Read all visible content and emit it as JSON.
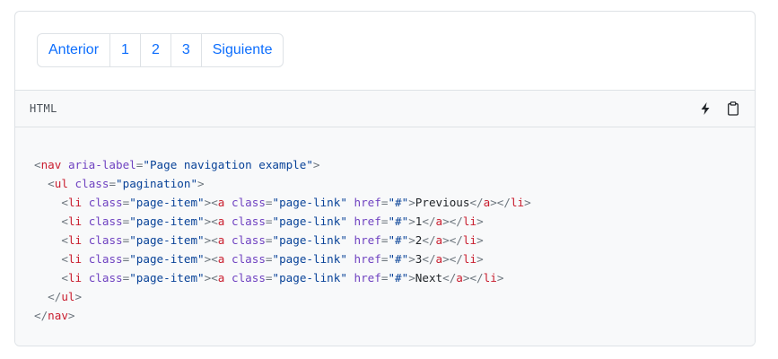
{
  "pagination": {
    "items": [
      {
        "label": "Anterior"
      },
      {
        "label": "1"
      },
      {
        "label": "2"
      },
      {
        "label": "3"
      },
      {
        "label": "Siguiente"
      }
    ]
  },
  "code": {
    "language": "HTML",
    "edit_icon": "lightning-icon",
    "copy_icon": "clipboard-icon",
    "lines": [
      {
        "indent": "",
        "parts": [
          [
            "punct",
            "<"
          ],
          [
            "tag",
            "nav"
          ],
          [
            "txt",
            " "
          ],
          [
            "attr",
            "aria-label"
          ],
          [
            "punct",
            "="
          ],
          [
            "val",
            "\"Page navigation example\""
          ],
          [
            "punct",
            ">"
          ]
        ]
      },
      {
        "indent": "  ",
        "parts": [
          [
            "punct",
            "<"
          ],
          [
            "tag",
            "ul"
          ],
          [
            "txt",
            " "
          ],
          [
            "attr",
            "class"
          ],
          [
            "punct",
            "="
          ],
          [
            "val",
            "\"pagination\""
          ],
          [
            "punct",
            ">"
          ]
        ]
      },
      {
        "indent": "    ",
        "parts": [
          [
            "punct",
            "<"
          ],
          [
            "tag",
            "li"
          ],
          [
            "txt",
            " "
          ],
          [
            "attr",
            "class"
          ],
          [
            "punct",
            "="
          ],
          [
            "val",
            "\"page-item\""
          ],
          [
            "punct",
            "><"
          ],
          [
            "tag",
            "a"
          ],
          [
            "txt",
            " "
          ],
          [
            "attr",
            "class"
          ],
          [
            "punct",
            "="
          ],
          [
            "val",
            "\"page-link\""
          ],
          [
            "txt",
            " "
          ],
          [
            "attr",
            "href"
          ],
          [
            "punct",
            "="
          ],
          [
            "val",
            "\"#\""
          ],
          [
            "punct",
            ">"
          ],
          [
            "txt",
            "Previous"
          ],
          [
            "punct",
            "</"
          ],
          [
            "tag",
            "a"
          ],
          [
            "punct",
            "></"
          ],
          [
            "tag",
            "li"
          ],
          [
            "punct",
            ">"
          ]
        ]
      },
      {
        "indent": "    ",
        "parts": [
          [
            "punct",
            "<"
          ],
          [
            "tag",
            "li"
          ],
          [
            "txt",
            " "
          ],
          [
            "attr",
            "class"
          ],
          [
            "punct",
            "="
          ],
          [
            "val",
            "\"page-item\""
          ],
          [
            "punct",
            "><"
          ],
          [
            "tag",
            "a"
          ],
          [
            "txt",
            " "
          ],
          [
            "attr",
            "class"
          ],
          [
            "punct",
            "="
          ],
          [
            "val",
            "\"page-link\""
          ],
          [
            "txt",
            " "
          ],
          [
            "attr",
            "href"
          ],
          [
            "punct",
            "="
          ],
          [
            "val",
            "\"#\""
          ],
          [
            "punct",
            ">"
          ],
          [
            "txt",
            "1"
          ],
          [
            "punct",
            "</"
          ],
          [
            "tag",
            "a"
          ],
          [
            "punct",
            "></"
          ],
          [
            "tag",
            "li"
          ],
          [
            "punct",
            ">"
          ]
        ]
      },
      {
        "indent": "    ",
        "parts": [
          [
            "punct",
            "<"
          ],
          [
            "tag",
            "li"
          ],
          [
            "txt",
            " "
          ],
          [
            "attr",
            "class"
          ],
          [
            "punct",
            "="
          ],
          [
            "val",
            "\"page-item\""
          ],
          [
            "punct",
            "><"
          ],
          [
            "tag",
            "a"
          ],
          [
            "txt",
            " "
          ],
          [
            "attr",
            "class"
          ],
          [
            "punct",
            "="
          ],
          [
            "val",
            "\"page-link\""
          ],
          [
            "txt",
            " "
          ],
          [
            "attr",
            "href"
          ],
          [
            "punct",
            "="
          ],
          [
            "val",
            "\"#\""
          ],
          [
            "punct",
            ">"
          ],
          [
            "txt",
            "2"
          ],
          [
            "punct",
            "</"
          ],
          [
            "tag",
            "a"
          ],
          [
            "punct",
            "></"
          ],
          [
            "tag",
            "li"
          ],
          [
            "punct",
            ">"
          ]
        ]
      },
      {
        "indent": "    ",
        "parts": [
          [
            "punct",
            "<"
          ],
          [
            "tag",
            "li"
          ],
          [
            "txt",
            " "
          ],
          [
            "attr",
            "class"
          ],
          [
            "punct",
            "="
          ],
          [
            "val",
            "\"page-item\""
          ],
          [
            "punct",
            "><"
          ],
          [
            "tag",
            "a"
          ],
          [
            "txt",
            " "
          ],
          [
            "attr",
            "class"
          ],
          [
            "punct",
            "="
          ],
          [
            "val",
            "\"page-link\""
          ],
          [
            "txt",
            " "
          ],
          [
            "attr",
            "href"
          ],
          [
            "punct",
            "="
          ],
          [
            "val",
            "\"#\""
          ],
          [
            "punct",
            ">"
          ],
          [
            "txt",
            "3"
          ],
          [
            "punct",
            "</"
          ],
          [
            "tag",
            "a"
          ],
          [
            "punct",
            "></"
          ],
          [
            "tag",
            "li"
          ],
          [
            "punct",
            ">"
          ]
        ]
      },
      {
        "indent": "    ",
        "parts": [
          [
            "punct",
            "<"
          ],
          [
            "tag",
            "li"
          ],
          [
            "txt",
            " "
          ],
          [
            "attr",
            "class"
          ],
          [
            "punct",
            "="
          ],
          [
            "val",
            "\"page-item\""
          ],
          [
            "punct",
            "><"
          ],
          [
            "tag",
            "a"
          ],
          [
            "txt",
            " "
          ],
          [
            "attr",
            "class"
          ],
          [
            "punct",
            "="
          ],
          [
            "val",
            "\"page-link\""
          ],
          [
            "txt",
            " "
          ],
          [
            "attr",
            "href"
          ],
          [
            "punct",
            "="
          ],
          [
            "val",
            "\"#\""
          ],
          [
            "punct",
            ">"
          ],
          [
            "txt",
            "Next"
          ],
          [
            "punct",
            "</"
          ],
          [
            "tag",
            "a"
          ],
          [
            "punct",
            "></"
          ],
          [
            "tag",
            "li"
          ],
          [
            "punct",
            ">"
          ]
        ]
      },
      {
        "indent": "  ",
        "parts": [
          [
            "punct",
            "</"
          ],
          [
            "tag",
            "ul"
          ],
          [
            "punct",
            ">"
          ]
        ]
      },
      {
        "indent": "",
        "parts": [
          [
            "punct",
            "</"
          ],
          [
            "tag",
            "nav"
          ],
          [
            "punct",
            ">"
          ]
        ]
      }
    ]
  }
}
